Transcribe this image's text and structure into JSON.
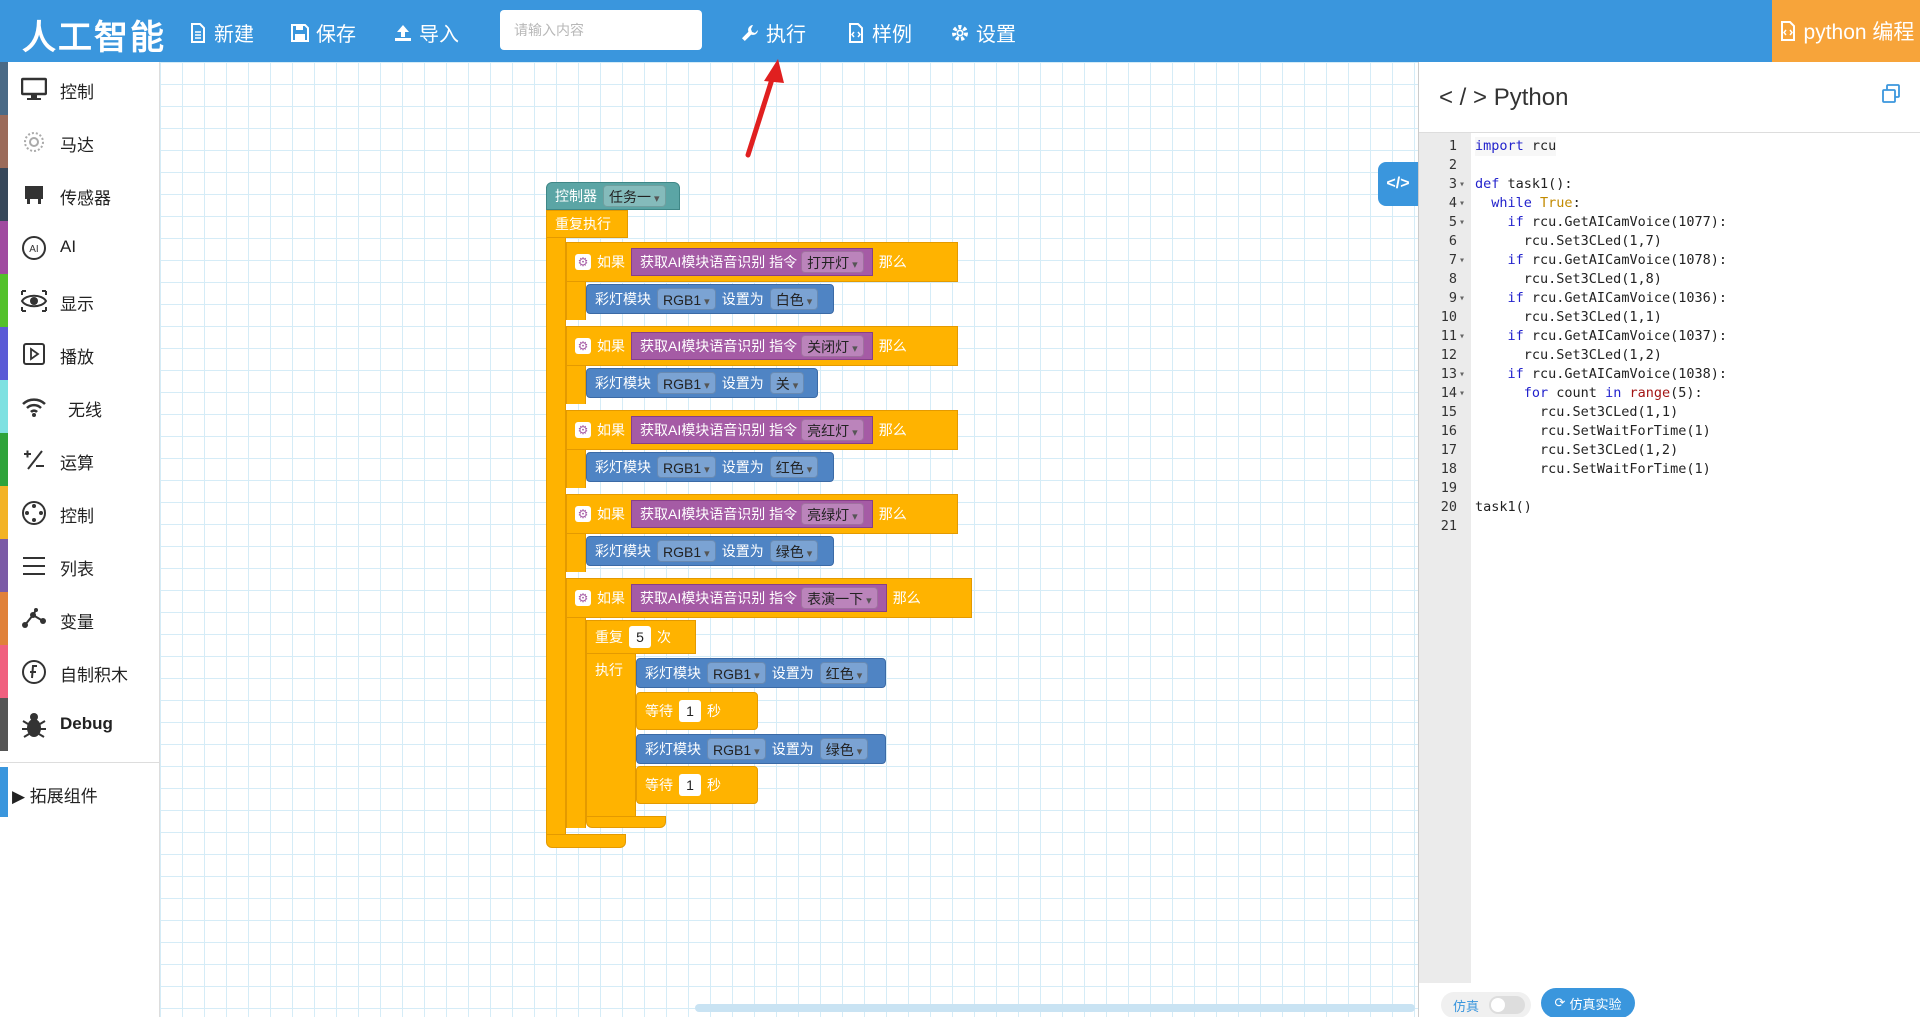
{
  "topbar": {
    "brand": "人工智能",
    "new_label": "新建",
    "save_label": "保存",
    "import_label": "导入",
    "search_placeholder": "请输入内容",
    "run_label": "执行",
    "examples_label": "样例",
    "settings_label": "设置",
    "python_label": "python 编程"
  },
  "sidebar": {
    "items": [
      {
        "label": "控制",
        "color": "#4a6a86",
        "icon": "monitor-icon"
      },
      {
        "label": "马达",
        "color": "#9b6b5a",
        "icon": "motor-icon"
      },
      {
        "label": "传感器",
        "color": "#37475a",
        "icon": "sensor-icon"
      },
      {
        "label": "AI",
        "color": "#a04aa0",
        "icon": "ai-icon"
      },
      {
        "label": "显示",
        "color": "#53c12b",
        "icon": "eye-icon"
      },
      {
        "label": "播放",
        "color": "#5b5bd6",
        "icon": "play-icon"
      },
      {
        "label": "无线",
        "color": "#7ee1e1",
        "icon": "wifi-icon"
      },
      {
        "label": "运算",
        "color": "#2ea33a",
        "icon": "math-icon"
      },
      {
        "label": "控制",
        "color": "#f3b326",
        "icon": "target-icon"
      },
      {
        "label": "列表",
        "color": "#7b5ba6",
        "icon": "list-icon"
      },
      {
        "label": "变量",
        "color": "#e0813a",
        "icon": "variable-icon"
      },
      {
        "label": "自制积木",
        "color": "#f0607f",
        "icon": "function-icon"
      },
      {
        "label": "Debug",
        "color": "#555555",
        "icon": "bug-icon"
      }
    ],
    "extension_label": "拓展组件"
  },
  "blocks": {
    "controller_label": "控制器",
    "task_value": "任务一",
    "repeat_forever": "重复执行",
    "if_label": "如果",
    "voice_label": "获取AI模块语音识别 指令",
    "then_label": "那么",
    "led_label": "彩灯模块",
    "rgb_value": "RGB1",
    "set_to": "设置为",
    "ifs": [
      {
        "command": "打开灯",
        "color": "白色"
      },
      {
        "command": "关闭灯",
        "color": "关"
      },
      {
        "command": "亮红灯",
        "color": "红色"
      },
      {
        "command": "亮绿灯",
        "color": "绿色"
      },
      {
        "command": "表演一下"
      }
    ],
    "repeat_label": "重复",
    "repeat_count": "5",
    "times_label": "次",
    "do_label": "执行",
    "inner": [
      {
        "color": "红色"
      },
      {
        "wait": "1"
      },
      {
        "color": "绿色"
      },
      {
        "wait": "1"
      }
    ],
    "wait_label": "等待",
    "seconds_label": "秒"
  },
  "code_panel": {
    "title": "< / > Python",
    "toggle_label": "</>",
    "lines": [
      {
        "n": "1",
        "fold": "",
        "code": "import rcu"
      },
      {
        "n": "2",
        "fold": "",
        "code": ""
      },
      {
        "n": "3",
        "fold": "▾",
        "code": "def task1():"
      },
      {
        "n": "4",
        "fold": "▾",
        "code": "  while True:"
      },
      {
        "n": "5",
        "fold": "▾",
        "code": "    if rcu.GetAICamVoice(1077):"
      },
      {
        "n": "6",
        "fold": "",
        "code": "      rcu.Set3CLed(1,7)"
      },
      {
        "n": "7",
        "fold": "▾",
        "code": "    if rcu.GetAICamVoice(1078):"
      },
      {
        "n": "8",
        "fold": "",
        "code": "      rcu.Set3CLed(1,8)"
      },
      {
        "n": "9",
        "fold": "▾",
        "code": "    if rcu.GetAICamVoice(1036):"
      },
      {
        "n": "10",
        "fold": "",
        "code": "      rcu.Set3CLed(1,1)"
      },
      {
        "n": "11",
        "fold": "▾",
        "code": "    if rcu.GetAICamVoice(1037):"
      },
      {
        "n": "12",
        "fold": "",
        "code": "      rcu.Set3CLed(1,2)"
      },
      {
        "n": "13",
        "fold": "▾",
        "code": "    if rcu.GetAICamVoice(1038):"
      },
      {
        "n": "14",
        "fold": "▾",
        "code": "      for count in range(5):"
      },
      {
        "n": "15",
        "fold": "",
        "code": "        rcu.Set3CLed(1,1)"
      },
      {
        "n": "16",
        "fold": "",
        "code": "        rcu.SetWaitForTime(1)"
      },
      {
        "n": "17",
        "fold": "",
        "code": "        rcu.Set3CLed(1,2)"
      },
      {
        "n": "18",
        "fold": "",
        "code": "        rcu.SetWaitForTime(1)"
      },
      {
        "n": "19",
        "fold": "",
        "code": ""
      },
      {
        "n": "20",
        "fold": "",
        "code": "task1()"
      },
      {
        "n": "21",
        "fold": "",
        "code": ""
      }
    ],
    "sim_label": "仿真",
    "sim_button": "仿真实验"
  }
}
